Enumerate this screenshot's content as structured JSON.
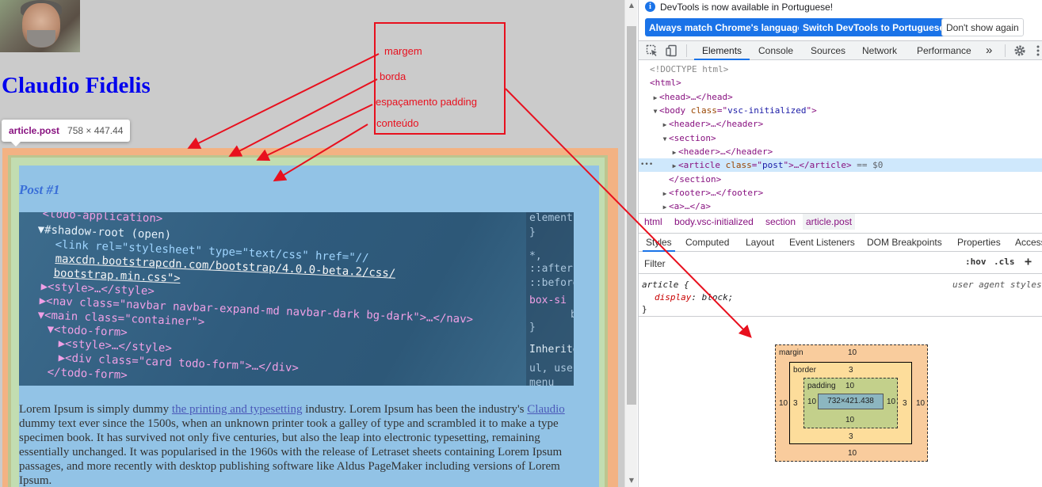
{
  "page": {
    "site_title": "Claudio Fidelis",
    "tooltip": {
      "tag": "article.post",
      "dims": "758 × 447.44"
    },
    "post_title": "Post #1",
    "code_image": {
      "lines": [
        "<todo-application>",
        "▼#shadow-root (open)",
        "<link rel=\"stylesheet\" type=\"text/css\" href=\"//",
        "maxcdn.bootstrapcdn.com/bootstrap/4.0.0-beta.2/css/",
        "bootstrap.min.css\">",
        "▶<style>…</style>",
        "▶<nav class=\"navbar navbar-expand-md navbar-dark bg-dark\">…</nav>",
        "▼<main class=\"container\">",
        "▼<todo-form>",
        "▶<style>…</style>",
        "▶<div class=\"card todo-form\">…</div>",
        "</todo-form>"
      ],
      "side": [
        "element.",
        "}",
        "*,",
        "::after,",
        "::before",
        "box-si",
        "box",
        "}",
        "Inherited fr",
        "ul,  user",
        "menu"
      ]
    },
    "body_text": {
      "part1": "Lorem Ipsum is simply dummy ",
      "link1": "the printing and typesetting",
      "part2": " industry. Lorem Ipsum has been the industry's ",
      "link2": "Claudio",
      "part3": " dummy text ever since the 1500s, when an unknown printer took a galley of type and scrambled it to make a type specimen book. It has survived not only five centuries, but also the leap into electronic typesetting, remaining essentially unchanged. It was popularised in the 1960s with the release of Letraset sheets containing Lorem Ipsum passages, and more recently with desktop publishing software like Aldus PageMaker including versions of Lorem Ipsum."
    }
  },
  "annotations": {
    "margin": "margem",
    "border": "borda",
    "padding": "espaçamento padding",
    "content": "conteúdo",
    "color": "#e8101e"
  },
  "devtools": {
    "info": "DevTools is now available in Portuguese!",
    "buttons": {
      "match": "Always match Chrome's language",
      "switch": "Switch DevTools to Portuguese",
      "dismiss": "Don't show again"
    },
    "tabs": [
      "Elements",
      "Console",
      "Sources",
      "Network",
      "Performance"
    ],
    "more_tabs": "»",
    "tree": {
      "doctype": "<!DOCTYPE html>",
      "html_open": "<html>",
      "head": "<head>…</head>",
      "body_tag": "body",
      "body_attr_name": "class",
      "body_attr_value": "vsc-initialized",
      "header1": "<header>…</header>",
      "section_open": "<section>",
      "header2": "<header>…</header>",
      "article_tag": "article",
      "article_attr_name": "class",
      "article_attr_value": "post",
      "article_tail": "…</article>",
      "selected_marker": "== $0",
      "dots": "•••",
      "section_close": "</section>",
      "footer": "<footer>…</footer>",
      "anchor": "<a>…</a>"
    },
    "breadcrumbs": [
      "html",
      "body.vsc-initialized",
      "section",
      "article.post"
    ],
    "subtabs": [
      "Styles",
      "Computed",
      "Layout",
      "Event Listeners",
      "DOM Breakpoints",
      "Properties",
      "Access"
    ],
    "filter_placeholder": "Filter",
    "hov": ":hov",
    "cls": ".cls",
    "plus": "+",
    "rule": {
      "selector": "article {",
      "source": "user agent styles",
      "prop": "display",
      "value": "block;",
      "close": "}"
    },
    "box_model": {
      "margin_label": "margin",
      "border_label": "border",
      "padding_label": "padding",
      "margin": {
        "top": "10",
        "right": "10",
        "bottom": "10",
        "left": "10"
      },
      "border": {
        "top": "3",
        "right": "3",
        "bottom": "3",
        "left": "3"
      },
      "padding": {
        "top": "10",
        "right": "10",
        "bottom": "10",
        "left": "10"
      },
      "content": "732×421.438"
    }
  }
}
